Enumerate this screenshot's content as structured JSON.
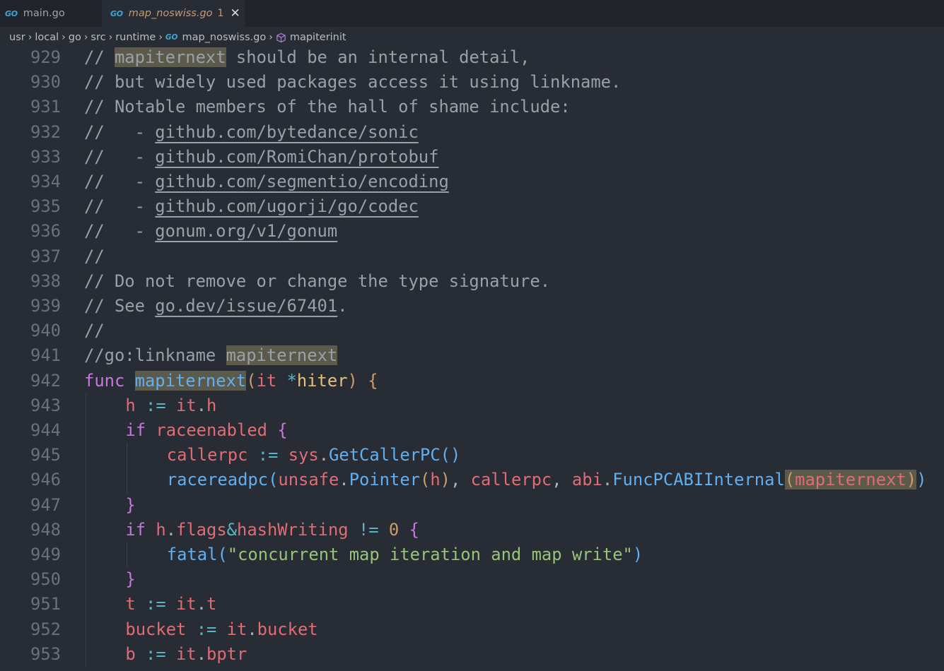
{
  "tabs": [
    {
      "icon": "go-icon",
      "label": "main.go",
      "active": false
    },
    {
      "icon": "go-icon",
      "label": "map_noswiss.go",
      "badge": "1",
      "active": true
    }
  ],
  "breadcrumb": [
    "usr",
    "local",
    "go",
    "src",
    "runtime",
    "map_noswiss.go",
    "mapiterinit"
  ],
  "editor": {
    "lines": [
      {
        "n": "929",
        "indent": 0,
        "segs": [
          [
            "c-cmt",
            "// "
          ],
          [
            "c-cmt hl",
            "mapiternext"
          ],
          [
            "c-cmt",
            " should be an internal detail,"
          ]
        ]
      },
      {
        "n": "930",
        "indent": 0,
        "segs": [
          [
            "c-cmt",
            "// but widely used packages access it using linkname."
          ]
        ]
      },
      {
        "n": "931",
        "indent": 0,
        "segs": [
          [
            "c-cmt",
            "// Notable members of the hall of shame include:"
          ]
        ]
      },
      {
        "n": "932",
        "indent": 0,
        "segs": [
          [
            "c-cmt",
            "//   - "
          ],
          [
            "c-cmt c-link",
            "github.com/bytedance/sonic"
          ]
        ]
      },
      {
        "n": "933",
        "indent": 0,
        "segs": [
          [
            "c-cmt",
            "//   - "
          ],
          [
            "c-cmt c-link",
            "github.com/RomiChan/protobuf"
          ]
        ]
      },
      {
        "n": "934",
        "indent": 0,
        "segs": [
          [
            "c-cmt",
            "//   - "
          ],
          [
            "c-cmt c-link",
            "github.com/segmentio/encoding"
          ]
        ]
      },
      {
        "n": "935",
        "indent": 0,
        "segs": [
          [
            "c-cmt",
            "//   - "
          ],
          [
            "c-cmt c-link",
            "github.com/ugorji/go/codec"
          ]
        ]
      },
      {
        "n": "936",
        "indent": 0,
        "segs": [
          [
            "c-cmt",
            "//   - "
          ],
          [
            "c-cmt c-link",
            "gonum.org/v1/gonum"
          ]
        ]
      },
      {
        "n": "937",
        "indent": 0,
        "segs": [
          [
            "c-cmt",
            "//"
          ]
        ]
      },
      {
        "n": "938",
        "indent": 0,
        "segs": [
          [
            "c-cmt",
            "// Do not remove or change the type signature."
          ]
        ]
      },
      {
        "n": "939",
        "indent": 0,
        "segs": [
          [
            "c-cmt",
            "// See "
          ],
          [
            "c-cmt c-link",
            "go.dev/issue/67401"
          ],
          [
            "c-cmt",
            "."
          ]
        ]
      },
      {
        "n": "940",
        "indent": 0,
        "segs": [
          [
            "c-cmt",
            "//"
          ]
        ]
      },
      {
        "n": "941",
        "indent": 0,
        "segs": [
          [
            "c-cmt",
            "//go:linkname "
          ],
          [
            "c-cmt hl",
            "mapiternext"
          ]
        ]
      },
      {
        "n": "942",
        "indent": 0,
        "segs": [
          [
            "c-kw",
            "func "
          ],
          [
            "hl-fn",
            "mapiternext"
          ],
          [
            "c-paren-y",
            "("
          ],
          [
            "c-var",
            "it "
          ],
          [
            "c-op",
            "*"
          ],
          [
            "c-type",
            "hiter"
          ],
          [
            "c-paren-y",
            ")"
          ],
          [
            "c-plain",
            " "
          ],
          [
            "c-paren-y",
            "{"
          ]
        ]
      },
      {
        "n": "943",
        "indent": 1,
        "segs": [
          [
            "c-var",
            "h "
          ],
          [
            "c-op",
            ":= "
          ],
          [
            "c-var",
            "it"
          ],
          [
            "c-plain",
            "."
          ],
          [
            "c-var",
            "h"
          ]
        ]
      },
      {
        "n": "944",
        "indent": 1,
        "segs": [
          [
            "c-kw",
            "if "
          ],
          [
            "c-var",
            "raceenabled "
          ],
          [
            "c-paren-p",
            "{"
          ]
        ]
      },
      {
        "n": "945",
        "indent": 2,
        "segs": [
          [
            "c-var",
            "callerpc "
          ],
          [
            "c-op",
            ":= "
          ],
          [
            "c-var",
            "sys"
          ],
          [
            "c-plain",
            "."
          ],
          [
            "c-fn",
            "GetCallerPC"
          ],
          [
            "c-paren-b",
            "()"
          ]
        ]
      },
      {
        "n": "946",
        "indent": 2,
        "segs": [
          [
            "c-fn",
            "racereadpc"
          ],
          [
            "c-paren-b",
            "("
          ],
          [
            "c-var",
            "unsafe"
          ],
          [
            "c-plain",
            "."
          ],
          [
            "c-fn",
            "Pointer"
          ],
          [
            "c-paren-y",
            "("
          ],
          [
            "c-var",
            "h"
          ],
          [
            "c-paren-y",
            ")"
          ],
          [
            "c-plain",
            ", "
          ],
          [
            "c-var",
            "callerpc"
          ],
          [
            "c-plain",
            ", "
          ],
          [
            "c-var",
            "abi"
          ],
          [
            "c-plain",
            "."
          ],
          [
            "c-fn",
            "FuncPCABIInternal"
          ],
          [
            "c-paren-y hl",
            "("
          ],
          [
            "c-var hl",
            "mapiternext"
          ],
          [
            "c-paren-y hl",
            ")"
          ],
          [
            "c-paren-b",
            ")"
          ]
        ]
      },
      {
        "n": "947",
        "indent": 1,
        "segs": [
          [
            "c-paren-p",
            "}"
          ]
        ]
      },
      {
        "n": "948",
        "indent": 1,
        "segs": [
          [
            "c-kw",
            "if "
          ],
          [
            "c-var",
            "h"
          ],
          [
            "c-plain",
            "."
          ],
          [
            "c-var",
            "flags"
          ],
          [
            "c-op",
            "&"
          ],
          [
            "c-var",
            "hashWriting "
          ],
          [
            "c-op",
            "!= "
          ],
          [
            "c-num",
            "0 "
          ],
          [
            "c-paren-p",
            "{"
          ]
        ]
      },
      {
        "n": "949",
        "indent": 2,
        "segs": [
          [
            "c-fn",
            "fatal"
          ],
          [
            "c-paren-b",
            "("
          ],
          [
            "c-str",
            "\"concurrent map iteration and map write\""
          ],
          [
            "c-paren-b",
            ")"
          ]
        ]
      },
      {
        "n": "950",
        "indent": 1,
        "segs": [
          [
            "c-paren-p",
            "}"
          ]
        ]
      },
      {
        "n": "951",
        "indent": 1,
        "segs": [
          [
            "c-var",
            "t "
          ],
          [
            "c-op",
            ":= "
          ],
          [
            "c-var",
            "it"
          ],
          [
            "c-plain",
            "."
          ],
          [
            "c-var",
            "t"
          ]
        ]
      },
      {
        "n": "952",
        "indent": 1,
        "segs": [
          [
            "c-var",
            "bucket "
          ],
          [
            "c-op",
            ":= "
          ],
          [
            "c-var",
            "it"
          ],
          [
            "c-plain",
            "."
          ],
          [
            "c-var",
            "bucket"
          ]
        ]
      },
      {
        "n": "953",
        "indent": 1,
        "segs": [
          [
            "c-var",
            "b "
          ],
          [
            "c-op",
            ":= "
          ],
          [
            "c-var",
            "it"
          ],
          [
            "c-plain",
            "."
          ],
          [
            "c-var",
            "bptr"
          ]
        ]
      }
    ]
  }
}
